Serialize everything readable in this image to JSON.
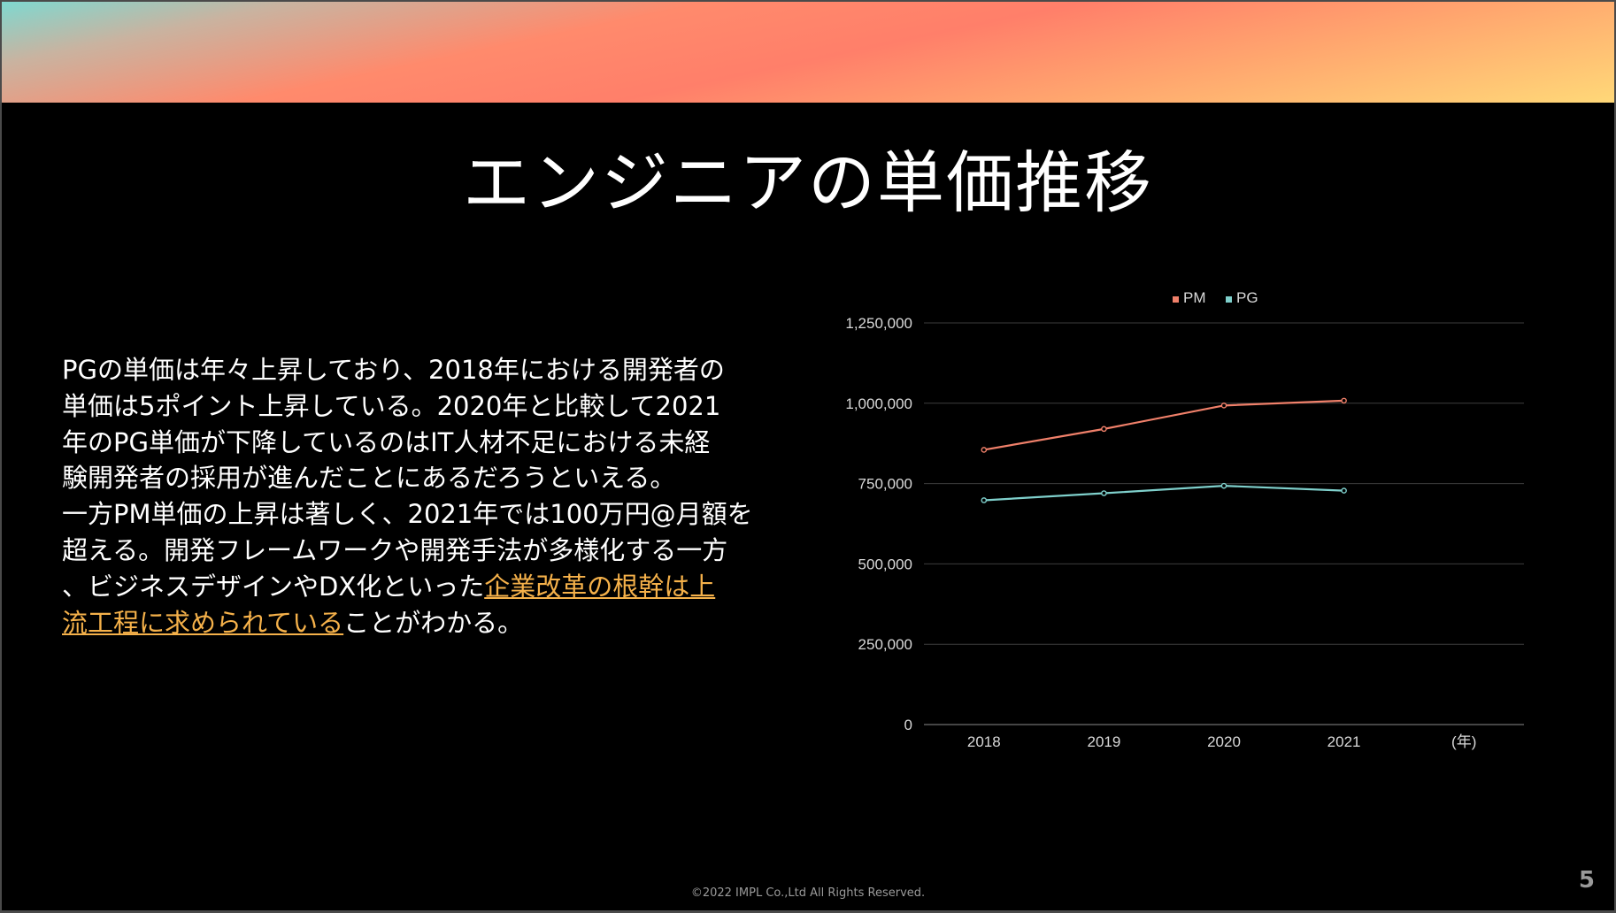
{
  "slide": {
    "title": "エンジニアの単価推移",
    "body": {
      "text_before": "PGの単価は年々上昇しており、2018年における開発者の\n単価は5ポイント上昇している。2020年と比較して2021\n年のPG単価が下降しているのはIT人材不足における未経\n験開発者の採用が進んだことにあるだろうといえる。\n一方PM単価の上昇は著しく、2021年では100万円@月額を\n超える。開発フレームワークや開発手法が多様化する一方\n、ビジネスデザインやDX化といった",
      "highlight": "企業改革の根幹は上\n流工程に求められている",
      "text_after": "ことがわかる。"
    },
    "footer": "©2022 IMPL Co.,Ltd All Rights Reserved.",
    "page_number": "5"
  },
  "colors": {
    "background": "#000000",
    "pm_line": "#f0806a",
    "pg_line": "#7fd0cc",
    "highlight_text": "#f5b14a"
  },
  "chart_data": {
    "type": "line",
    "categories": [
      "2018",
      "2019",
      "2020",
      "2021",
      "(年)"
    ],
    "series": [
      {
        "name": "PM",
        "color": "#f0806a",
        "values": [
          855000,
          920000,
          993000,
          1008000,
          null
        ]
      },
      {
        "name": "PG",
        "color": "#7fd0cc",
        "values": [
          698000,
          720000,
          743000,
          728000,
          null
        ]
      }
    ],
    "ylim": [
      0,
      1250000
    ],
    "yticks": [
      0,
      250000,
      500000,
      750000,
      1000000,
      1250000
    ],
    "ytick_labels": [
      "0",
      "250,000",
      "500,000",
      "750,000",
      "1,000,000",
      "1,250,000"
    ],
    "grid": true,
    "legend": "top"
  }
}
